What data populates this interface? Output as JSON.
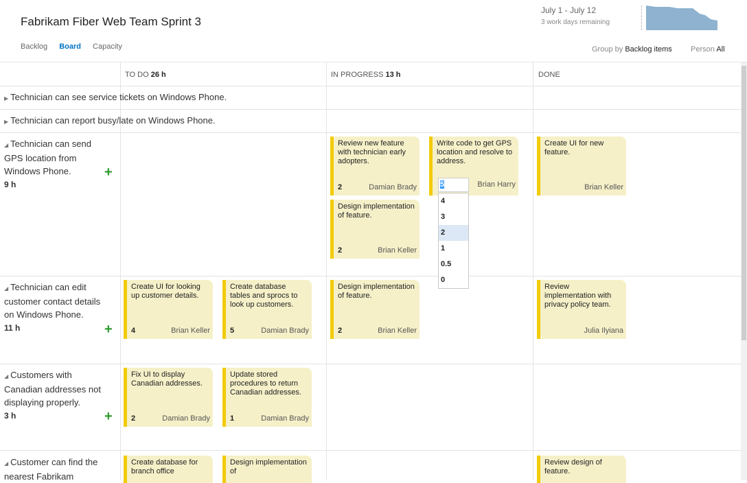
{
  "header": {
    "title": "Fabrikam Fiber Web Team Sprint 3",
    "tabs": [
      "Backlog",
      "Board",
      "Capacity"
    ],
    "date_range": "July 1 - July 12",
    "remaining": "3 work days remaining",
    "group_by_label": "Group by",
    "group_by_value": "Backlog items",
    "person_label": "Person",
    "person_value": "All"
  },
  "columns": [
    {
      "name": "TO DO",
      "hours": "26 h"
    },
    {
      "name": "IN PROGRESS",
      "hours": "13 h"
    },
    {
      "name": "DONE",
      "hours": ""
    }
  ],
  "collapsed_stories": [
    "Technician can see service tickets on Windows Phone.",
    "Technician can report busy/late on Windows Phone."
  ],
  "stories": [
    {
      "title": "Technician can send GPS location from Windows Phone.",
      "hours": "9 h"
    },
    {
      "title": "Technician can edit customer contact details on Windows Phone.",
      "hours": "11 h"
    },
    {
      "title": "Customers with Canadian addresses not displaying properly.",
      "hours": "3 h"
    },
    {
      "title": "Customer can find the nearest Fabrikam",
      "hours": ""
    }
  ],
  "cards": [
    {
      "text": "Review new feature with technician early adopters.",
      "remaining": "2",
      "owner": "Damian Brady"
    },
    {
      "text": "Write code to get GPS location and resolve to address.",
      "remaining": "5",
      "owner": "Brian Harry"
    },
    {
      "text": "Create UI for new feature.",
      "remaining": "",
      "owner": "Brian Keller"
    },
    {
      "text": "Design implementation of feature.",
      "remaining": "2",
      "owner": "Brian Keller"
    },
    {
      "text": "Create UI for looking up customer details.",
      "remaining": "4",
      "owner": "Brian Keller"
    },
    {
      "text": "Create database tables and sprocs to look up customers.",
      "remaining": "5",
      "owner": "Damian Brady"
    },
    {
      "text": "Design implementation of feature.",
      "remaining": "2",
      "owner": "Brian Keller"
    },
    {
      "text": "Review implementation with privacy policy team.",
      "remaining": "",
      "owner": "Julia Ilyiana"
    },
    {
      "text": "Fix UI to display Canadian addresses.",
      "remaining": "2",
      "owner": "Damian Brady"
    },
    {
      "text": "Update stored procedures to return Canadian addresses.",
      "remaining": "1",
      "owner": "Damian Brady"
    },
    {
      "text": "Create database for branch office",
      "remaining": "",
      "owner": ""
    },
    {
      "text": "Design implementation of",
      "remaining": "",
      "owner": ""
    },
    {
      "text": "Review design of feature.",
      "remaining": "",
      "owner": ""
    }
  ],
  "remaining_dropdown": {
    "current": "5",
    "options": [
      "4",
      "3",
      "2",
      "1",
      "0.5",
      "0"
    ],
    "selected": "2"
  },
  "colors": {
    "card_bg": "#f5f0c8",
    "card_bar": "#f2cb0b",
    "accent": "#0072c6",
    "add_icon": "#2e9b2e"
  }
}
